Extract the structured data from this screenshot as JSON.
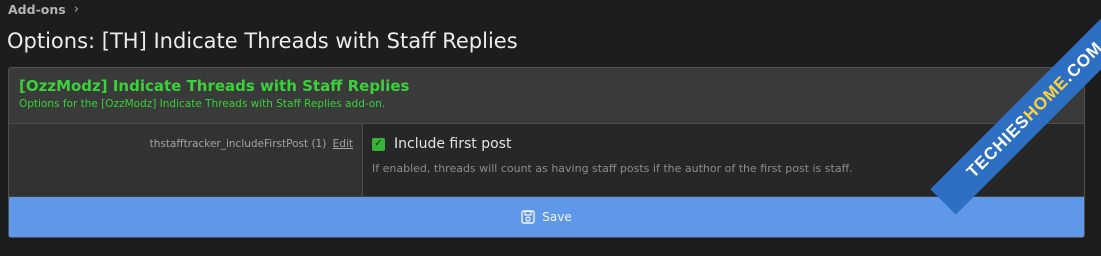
{
  "breadcrumb": {
    "items": [
      "Add-ons"
    ]
  },
  "page": {
    "title": "Options: [TH] Indicate Threads with Staff Replies"
  },
  "panel": {
    "title": "[OzzModz] Indicate Threads with Staff Replies",
    "description": "Options for the [OzzModz] Indicate Threads with Staff Replies add-on."
  },
  "option": {
    "name": "thstafftracker_includeFirstPost",
    "display_order": "(1)",
    "edit_label": "Edit",
    "checkbox_label": "Include first post",
    "checked": true,
    "hint": "If enabled, threads will count as having staff posts if the author of the first post is staff."
  },
  "save_button": {
    "label": "Save",
    "icon": "save-icon",
    "color": "#5f98e8"
  },
  "watermark": {
    "part1": "TECHIES",
    "part2": "HOME",
    "part3": ".COM"
  },
  "colors": {
    "accent_green": "#3ad13a",
    "background": "#1d1d1d"
  }
}
